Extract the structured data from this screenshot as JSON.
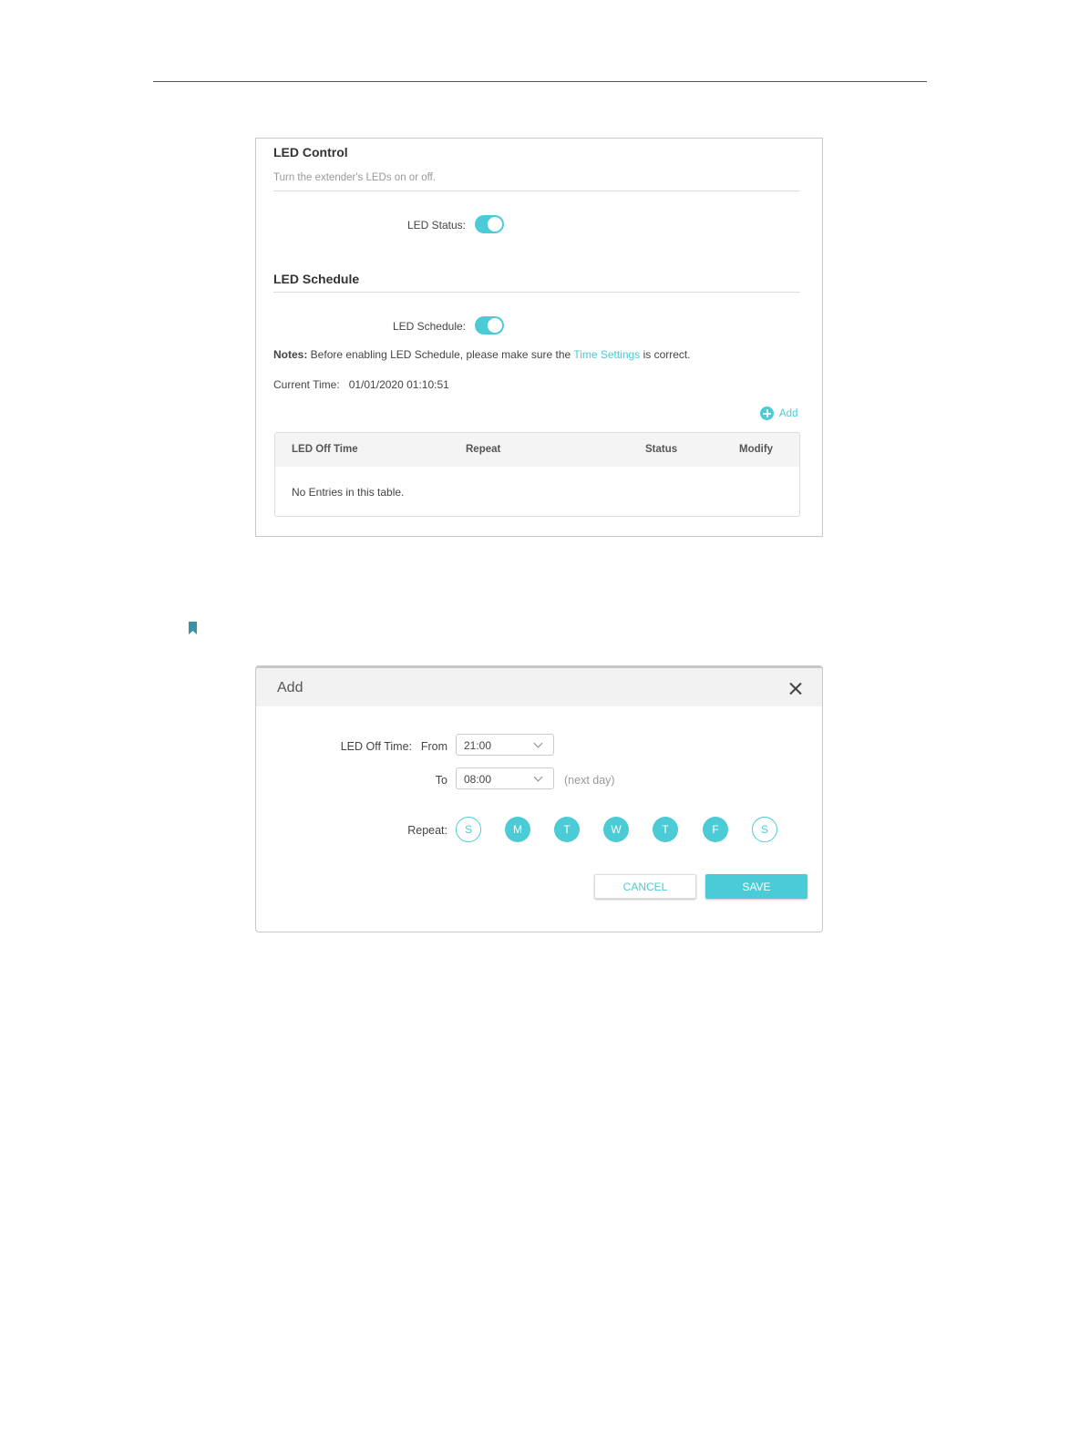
{
  "led_control": {
    "title": "LED Control",
    "subtitle": "Turn the extender's LEDs on or off.",
    "status_label": "LED Status:",
    "status_on": true
  },
  "led_schedule": {
    "title": "LED Schedule",
    "schedule_label": "LED Schedule:",
    "schedule_on": true,
    "notes_prefix": "Notes:",
    "notes_text": " Before enabling LED Schedule, please make sure the ",
    "notes_link": "Time Settings",
    "notes_suffix": " is correct.",
    "current_time_label": "Current Time:",
    "current_time_value": "01/01/2020 01:10:51",
    "add_label": "Add",
    "table": {
      "headers": [
        "LED Off Time",
        "Repeat",
        "Status",
        "Modify"
      ],
      "empty_text": "No Entries in this table."
    }
  },
  "add_dialog": {
    "title": "Add",
    "led_off_time_label": "LED Off Time:",
    "from_label": "From",
    "from_value": "21:00",
    "to_label": "To",
    "to_value": "08:00",
    "next_day": "(next day)",
    "repeat_label": "Repeat:",
    "days": [
      {
        "label": "S",
        "selected": false
      },
      {
        "label": "M",
        "selected": true
      },
      {
        "label": "T",
        "selected": true
      },
      {
        "label": "W",
        "selected": true
      },
      {
        "label": "T",
        "selected": true
      },
      {
        "label": "F",
        "selected": true
      },
      {
        "label": "S",
        "selected": false
      }
    ],
    "cancel_label": "CANCEL",
    "save_label": "SAVE"
  },
  "colors": {
    "accent": "#4acbd6",
    "bookmark": "#3a93a5"
  }
}
